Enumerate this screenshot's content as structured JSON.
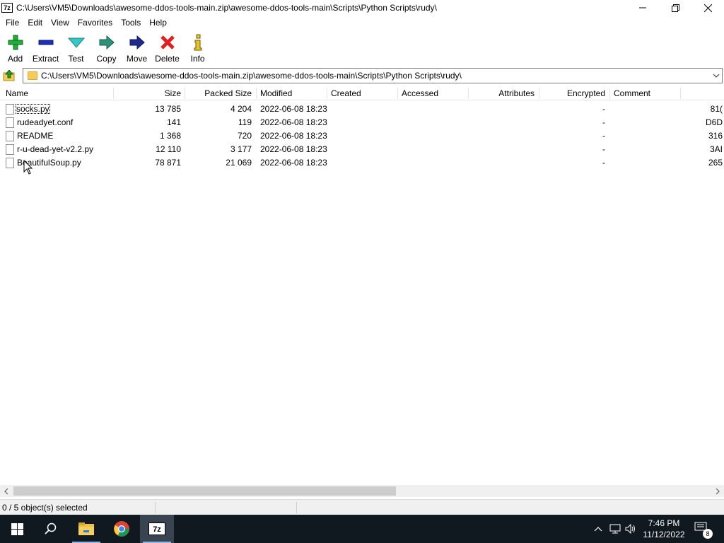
{
  "window": {
    "title": "C:\\Users\\VM5\\Downloads\\awesome-ddos-tools-main.zip\\awesome-ddos-tools-main\\Scripts\\Python Scripts\\rudy\\",
    "app_icon_text": "7z"
  },
  "menu": [
    "File",
    "Edit",
    "View",
    "Favorites",
    "Tools",
    "Help"
  ],
  "toolbar": {
    "add": "Add",
    "extract": "Extract",
    "test": "Test",
    "copy": "Copy",
    "move": "Move",
    "delete": "Delete",
    "info": "Info"
  },
  "address": {
    "path": "C:\\Users\\VM5\\Downloads\\awesome-ddos-tools-main.zip\\awesome-ddos-tools-main\\Scripts\\Python Scripts\\rudy\\"
  },
  "columns": {
    "name": "Name",
    "size": "Size",
    "packed": "Packed Size",
    "modified": "Modified",
    "created": "Created",
    "accessed": "Accessed",
    "attributes": "Attributes",
    "encrypted": "Encrypted",
    "comment": "Comment"
  },
  "files": [
    {
      "name": "socks.py",
      "size": "13 785",
      "packed": "4 204",
      "modified": "2022-06-08 18:23",
      "encrypted": "-",
      "crc": "81("
    },
    {
      "name": "rudeadyet.conf",
      "size": "141",
      "packed": "119",
      "modified": "2022-06-08 18:23",
      "encrypted": "-",
      "crc": "D6D"
    },
    {
      "name": "README",
      "size": "1 368",
      "packed": "720",
      "modified": "2022-06-08 18:23",
      "encrypted": "-",
      "crc": "316"
    },
    {
      "name": "r-u-dead-yet-v2.2.py",
      "size": "12 110",
      "packed": "3 177",
      "modified": "2022-06-08 18:23",
      "encrypted": "-",
      "crc": "3AI"
    },
    {
      "name": "BeautifulSoup.py",
      "size": "78 871",
      "packed": "21 069",
      "modified": "2022-06-08 18:23",
      "encrypted": "-",
      "crc": "265"
    }
  ],
  "status": {
    "selection": "0 / 5 object(s) selected"
  },
  "taskbar": {
    "time": "7:46 PM",
    "date": "11/12/2022",
    "notifications": "8",
    "active_app_label": "7z"
  },
  "colors": {
    "taskbar_bg": "#101820",
    "add_green": "#1fae3a",
    "extract_blue": "#1d2fb8",
    "test_cyan": "#36c6c6",
    "copy_teal": "#2f8f7a",
    "move_navy": "#1f2a8f",
    "delete_red": "#e02020",
    "info_yellow": "#e8c520"
  }
}
